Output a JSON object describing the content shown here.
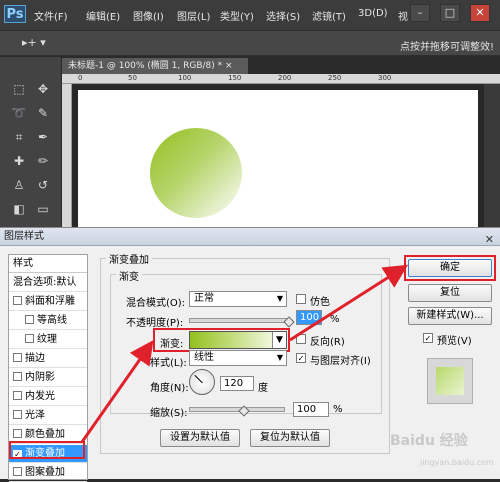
{
  "app": {
    "logo": "Ps",
    "menu": [
      "文件(F)",
      "编辑(E)",
      "图像(I)",
      "图层(L)",
      "类型(Y)",
      "选择(S)",
      "滤镜(T)",
      "3D(D)",
      "视"
    ],
    "window_buttons": [
      "–",
      "□",
      "✕"
    ],
    "options_tool": "▸+ ▾",
    "options_hint": "点按并拖移可调整效!"
  },
  "document": {
    "tab": "未标题-1 @ 100% (椭圆 1, RGB/8) *  ×",
    "ruler_labels": [
      "0",
      "50",
      "100",
      "150",
      "200",
      "250",
      "300"
    ]
  },
  "dialog": {
    "title": "图层样式",
    "close": "✕",
    "styles_header": "样式",
    "style_items": [
      {
        "label": "混合选项:默认",
        "checkbox": false,
        "checked": false,
        "indent": false,
        "selected": false
      },
      {
        "label": "斜面和浮雕",
        "checkbox": true,
        "checked": false,
        "indent": false,
        "selected": false
      },
      {
        "label": "等高线",
        "checkbox": true,
        "checked": false,
        "indent": true,
        "selected": false
      },
      {
        "label": "纹理",
        "checkbox": true,
        "checked": false,
        "indent": true,
        "selected": false
      },
      {
        "label": "描边",
        "checkbox": true,
        "checked": false,
        "indent": false,
        "selected": false
      },
      {
        "label": "内阴影",
        "checkbox": true,
        "checked": false,
        "indent": false,
        "selected": false
      },
      {
        "label": "内发光",
        "checkbox": true,
        "checked": false,
        "indent": false,
        "selected": false
      },
      {
        "label": "光泽",
        "checkbox": true,
        "checked": false,
        "indent": false,
        "selected": false
      },
      {
        "label": "颜色叠加",
        "checkbox": true,
        "checked": false,
        "indent": false,
        "selected": false
      },
      {
        "label": "渐变叠加",
        "checkbox": true,
        "checked": true,
        "indent": false,
        "selected": true
      },
      {
        "label": "图案叠加",
        "checkbox": true,
        "checked": false,
        "indent": false,
        "selected": false
      }
    ],
    "section_title": "渐变叠加",
    "group_title": "渐变",
    "blend_mode_label": "混合模式(O):",
    "blend_mode_value": "正常",
    "dither_label": "仿色",
    "opacity_label": "不透明度(P):",
    "opacity_value": "100",
    "percent": "%",
    "gradient_label": "渐变:",
    "reverse_label": "反向(R)",
    "style_label": "样式(L):",
    "style_value": "线性",
    "align_label": "与图层对齐(I)",
    "angle_label": "角度(N):",
    "angle_value": "120",
    "angle_unit": "度",
    "scale_label": "缩放(S):",
    "scale_value": "100",
    "set_default": "设置为默认值",
    "reset_default": "复位为默认值",
    "ok": "确定",
    "reset": "复位",
    "new_style": "新建样式(W)...",
    "preview_label": "预览(V)",
    "preview_checked": true,
    "align_checked": true
  },
  "watermark": {
    "text": "Baidu 经验",
    "sub": "jingyan.baidu.com"
  },
  "colors": {
    "gradient_start": "#94c11f",
    "gradient_end": "#ffffff",
    "highlight": "#e0202a",
    "selection": "#3399ff"
  }
}
